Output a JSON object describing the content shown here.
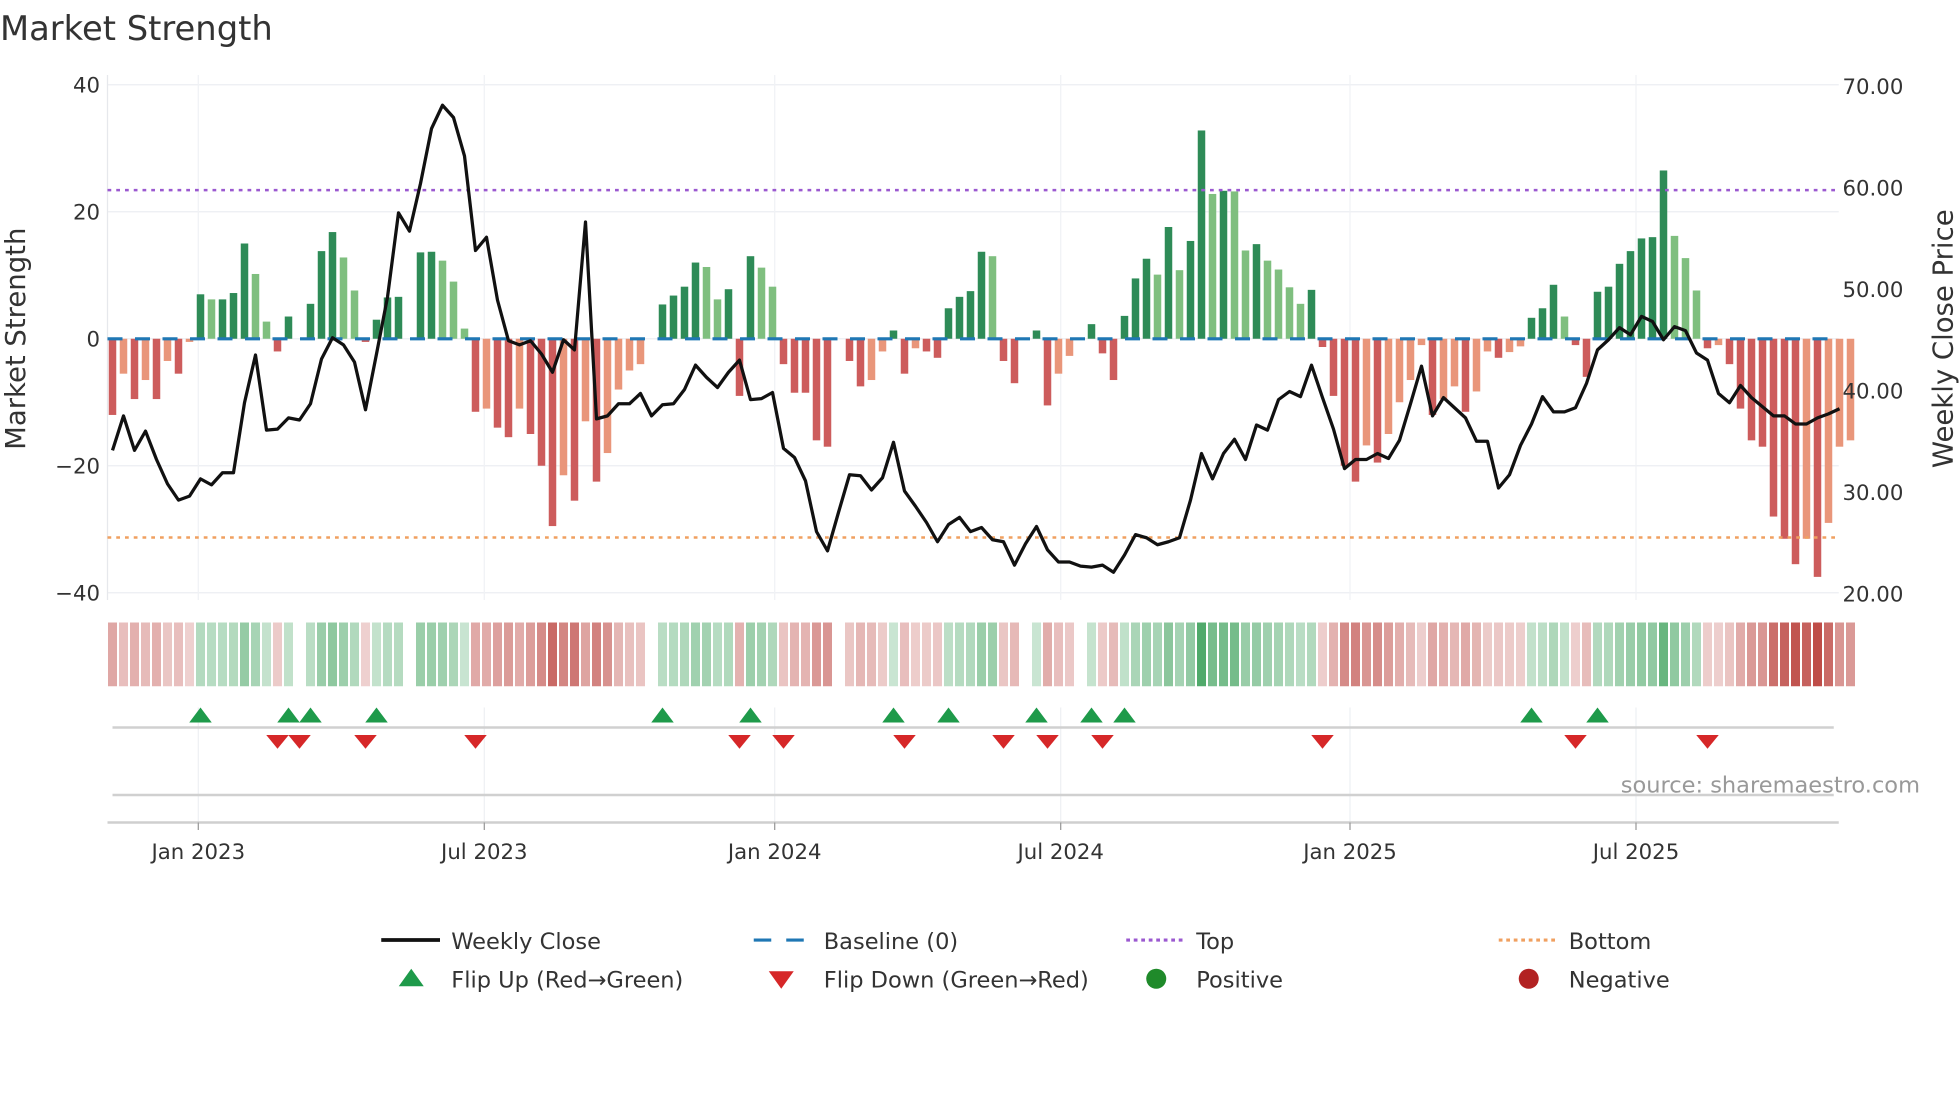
{
  "chart_data": {
    "type": "bar",
    "title": "Market Strength",
    "ylabel": "Market Strength",
    "y2label": "Weekly Close Price",
    "ylim": [
      -40,
      40
    ],
    "y2lim": [
      20,
      70
    ],
    "yticks": [
      "40",
      "20",
      "0",
      "−20",
      "−40"
    ],
    "ytick_values": [
      40,
      20,
      0,
      -20,
      -40
    ],
    "y2ticks": [
      "70.00",
      "60.00",
      "50.00",
      "40.00",
      "30.00",
      "20.00"
    ],
    "y2tick_values": [
      70,
      60,
      50,
      40,
      30,
      20
    ],
    "xticks": [
      "Jan 2023",
      "Jul 2023",
      "Jan 2024",
      "Jul 2024",
      "Jan 2025",
      "Jul 2025"
    ],
    "xtick_weeks": [
      7.8,
      33.8,
      60.2,
      86.2,
      112.5,
      138.5
    ],
    "frequency": "weekly",
    "top_level": 23.4,
    "bottom_level": -31.3,
    "baseline": 0,
    "grid": true,
    "strength": [
      -12,
      -5.5,
      -9.5,
      -6.5,
      -9.5,
      -3.5,
      -5.5,
      -0.5,
      7,
      6.2,
      6.2,
      7.2,
      15,
      10.2,
      2.7,
      -2,
      3.5,
      0,
      5.5,
      13.8,
      16.8,
      12.8,
      7.6,
      -0.5,
      3,
      6.5,
      6.6,
      0,
      13.6,
      13.7,
      12.3,
      9,
      1.6,
      -11.5,
      -11,
      -14,
      -15.5,
      -11,
      -15,
      -20,
      -29.5,
      -21.5,
      -25.5,
      -13,
      -22.5,
      -18,
      -8,
      -5,
      -4,
      0,
      5.4,
      6.8,
      8.2,
      12,
      11.3,
      6.2,
      7.8,
      -9,
      13,
      11.2,
      8.2,
      -4,
      -8.5,
      -8.5,
      -16,
      -17,
      0,
      -3.5,
      -7.5,
      -6.5,
      -2,
      1.3,
      -5.5,
      -1.5,
      -2,
      -3,
      4.8,
      6.6,
      7.5,
      13.7,
      13,
      -3.5,
      -7,
      0,
      1.3,
      -10.5,
      -5.5,
      -2.7,
      0,
      2.3,
      -2.3,
      -6.5,
      3.6,
      9.5,
      12.6,
      10.1,
      17.6,
      10.8,
      15.4,
      32.8,
      22.8,
      23.3,
      23.2,
      13.9,
      14.9,
      12.3,
      10.9,
      8.1,
      5.5,
      7.7,
      -1.3,
      -9,
      -20,
      -22.5,
      -16.8,
      -19.5,
      -15,
      -10,
      -6.5,
      -1,
      -12,
      -9.5,
      -7.5,
      -11.5,
      -8.3,
      -2,
      -3,
      -2.1,
      -1.2,
      3.3,
      4.8,
      8.5,
      3.5,
      -1,
      -6,
      7.4,
      8.2,
      11.8,
      13.8,
      15.8,
      16,
      26.5,
      16.2,
      12.7,
      7.6,
      -1.5,
      -1,
      -4,
      -11,
      -16,
      -17,
      -28,
      -31.5,
      -35.5,
      -31.5,
      -37.5,
      -29,
      -17,
      -16
    ],
    "weekly_close": [
      34.0,
      37.4,
      34.0,
      35.9,
      33.1,
      30.7,
      29.1,
      29.5,
      31.2,
      30.6,
      31.8,
      31.8,
      38.7,
      43.4,
      36.0,
      36.1,
      37.2,
      37.0,
      38.6,
      43.0,
      45.1,
      44.4,
      42.7,
      38.0,
      43.5,
      49.1,
      57.4,
      55.6,
      60.3,
      65.7,
      68.0,
      66.8,
      63.0,
      53.7,
      55.0,
      48.8,
      44.8,
      44.4,
      44.8,
      43.5,
      41.7,
      44.9,
      43.9,
      56.5,
      37.1,
      37.4,
      38.6,
      38.6,
      39.6,
      37.4,
      38.5,
      38.6,
      40.0,
      42.4,
      41.2,
      40.2,
      41.7,
      42.9,
      39.0,
      39.1,
      39.7,
      34.2,
      33.3,
      31.0,
      26.0,
      24.1,
      27.9,
      31.6,
      31.5,
      30.1,
      31.3,
      34.8,
      30.0,
      28.5,
      26.9,
      25.0,
      26.7,
      27.4,
      26.0,
      26.4,
      25.2,
      25.0,
      22.7,
      24.8,
      26.5,
      24.2,
      23.0,
      23.0,
      22.6,
      22.5,
      22.7,
      22.0,
      23.7,
      25.7,
      25.4,
      24.7,
      25.0,
      25.4,
      29.1,
      33.7,
      31.2,
      33.7,
      35.1,
      33.1,
      36.5,
      36.0,
      39.0,
      39.8,
      39.3,
      42.4,
      39.2,
      36.1,
      32.2,
      33.1,
      33.1,
      33.7,
      33.2,
      35.0,
      38.6,
      42.3,
      37.4,
      39.2,
      38.2,
      37.2,
      34.9,
      34.9,
      30.3,
      31.6,
      34.5,
      36.6,
      39.3,
      37.8,
      37.8,
      38.2,
      40.6,
      43.9,
      44.9,
      46.1,
      45.4,
      47.2,
      46.7,
      44.9,
      46.2,
      45.8,
      43.6,
      42.9,
      39.6,
      38.7,
      40.4,
      39.2,
      38.3,
      37.4,
      37.4,
      36.6,
      36.6,
      37.2,
      37.6,
      38.1
    ],
    "flip_up_weeks": [
      8,
      16,
      18,
      24,
      50,
      58,
      71,
      76,
      84,
      89,
      92,
      129,
      135
    ],
    "flip_down_weeks": [
      15,
      17,
      23,
      33,
      57,
      61,
      72,
      81,
      85,
      90,
      110,
      133,
      145
    ],
    "legend": [
      {
        "label": "Weekly Close",
        "kind": "line",
        "color": "#111111"
      },
      {
        "label": "Baseline (0)",
        "kind": "dash",
        "color": "#1f77b4"
      },
      {
        "label": "Top",
        "kind": "dot",
        "color": "#9b59d0"
      },
      {
        "label": "Bottom",
        "kind": "dot",
        "color": "#f0a060"
      },
      {
        "label": "Flip Up (Red→Green)",
        "kind": "tri-up",
        "color": "#1e9a4a"
      },
      {
        "label": "Flip Down (Green→Red)",
        "kind": "tri-down",
        "color": "#d62728"
      },
      {
        "label": "Positive",
        "kind": "dot-marker",
        "color": "#1f8a2a"
      },
      {
        "label": "Negative",
        "kind": "dot-marker",
        "color": "#b22222"
      }
    ],
    "legend_position": "bottom",
    "colors": {
      "pos_strong": "#2e8b57",
      "pos_weak": "#7fbf7f",
      "neg_strong": "#cd5c5c",
      "neg_weak": "#e9967a",
      "top": "#9b59d0",
      "bottom": "#f0a060",
      "baseline": "#1f77b4",
      "close": "#111111"
    },
    "source": "source: sharemaestro.com"
  }
}
